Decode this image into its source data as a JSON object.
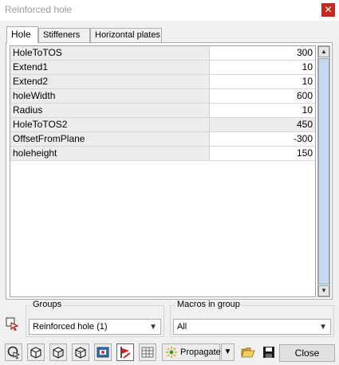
{
  "window": {
    "title": "Reinforced hole",
    "close_glyph": "✕"
  },
  "tabs": [
    {
      "label": "Hole",
      "active": true
    },
    {
      "label": "Stiffeners",
      "active": false
    },
    {
      "label": "Horizontal plates",
      "active": false
    }
  ],
  "properties": [
    {
      "name": "HoleToTOS",
      "value": "300"
    },
    {
      "name": "Extend1",
      "value": "10"
    },
    {
      "name": "Extend2",
      "value": "10"
    },
    {
      "name": "holeWidth",
      "value": "600"
    },
    {
      "name": "Radius",
      "value": "10"
    },
    {
      "name": "HoleToTOS2",
      "value": "450"
    },
    {
      "name": "OffsetFromPlane",
      "value": "-300"
    },
    {
      "name": "holeheight",
      "value": "150"
    }
  ],
  "groups": {
    "label": "Groups",
    "selected": "Reinforced hole (1)"
  },
  "macros": {
    "label": "Macros in group",
    "selected": "All"
  },
  "toolbar": {
    "icons": [
      "pick-object-icon",
      "cube-icon",
      "cube-selected-icon",
      "cube-wireframe-icon",
      "load-into-model-icon",
      "red-flag-icon",
      "table-grid-icon"
    ],
    "propagate_label": "Propagate",
    "close_label": "Close"
  },
  "colors": {
    "accent_close": "#c42b1c",
    "scroll_thumb": "#c8d8ec"
  }
}
